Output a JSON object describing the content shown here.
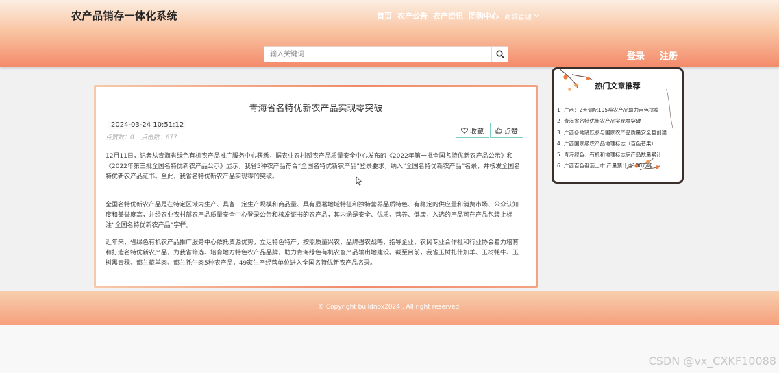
{
  "header": {
    "site_title": "农产品销存一体化系统",
    "nav": [
      {
        "label": "首页"
      },
      {
        "label": "农产公告"
      },
      {
        "label": "农产资讯"
      },
      {
        "label": "团购中心"
      }
    ],
    "nav_dropdown": "商城管理",
    "search_placeholder": "输入关键词",
    "login": "登录",
    "register": "注册"
  },
  "article": {
    "title": "青海省名特优新农产品实现零突破",
    "date": "2024-03-24 10:51:12",
    "likes_text": "点赞数：0",
    "clicks_text": "点击数：677",
    "favorite_label": "收藏",
    "like_label": "点赞",
    "paragraphs": [
      "12月11日，记者从青海省绿色有机农产品推广服务中心获悉，据农业农村部农产品质量安全中心发布的《2022年第一批全国名特优新农产品公示》和《2022年第三批全国名特优新农产品公示》显示，我省5种农产品符合“全国名特优新农产品”登录要求，纳入“全国名特优新农产品”名录，并核发全国名特优新农产品证书。至此，我省名特优新农产品实现零的突破。",
      "全国名特优新农产品是在特定区域内生产、具备一定生产规模和商品量、具有显著地域特征和独特营养品质特色、有稳定的供应量和消费市场、公众认知度和美誉度高，并经农业农村部农产品质量安全中心登录公告和核发证书的农产品，其内涵是安全、优质、营养、健康，入选的产品可在产品包装上标注“全国名特优新农产品”字样。",
      "近年来，省绿色有机农产品推广服务中心依托资源优势，立足特色特产，按照质量兴农、品牌强农战略，指导企业、农民专业合作社和行业协会着力培育和打造名特优新农产品，为我省筛选、培育地方特色农产品品牌，助力青海绿色有机农畜产品输出地建设。截至目前，我省玉树扎什加羊、玉树牦牛、玉树黑青稞、都兰藏羊肉、都兰牦牛肉5种农产品，49家生产经营单位进入全国名特优新农产品名录。"
    ]
  },
  "sidebar": {
    "title": "热门文章推荐",
    "items": [
      {
        "num": "1",
        "text": "广西：2天调配105吨农产品助力百色抗疫"
      },
      {
        "num": "2",
        "text": "青海省名特优新农产品实现零突破"
      },
      {
        "num": "3",
        "text": "广西各地踊跃参与国家农产品质量安全县创建"
      },
      {
        "num": "4",
        "text": "广西国家级农产品地理标志（百色芒果）"
      },
      {
        "num": "5",
        "text": "青海绿色、有机和地理标志农产品数量累计..."
      },
      {
        "num": "6",
        "text": "广西百色番茄上市 产量预计达100万吨"
      }
    ]
  },
  "footer": {
    "copyright": "© Copyright buildnox2024 . All right reserved."
  },
  "watermark": "CSDN @vx_CXKF10088",
  "colors": {
    "header_top": "#fbeee3",
    "header_bottom": "#f48a6a",
    "accent_border": "#7fcfc9",
    "sidebar_border": "#3a2f2a"
  }
}
